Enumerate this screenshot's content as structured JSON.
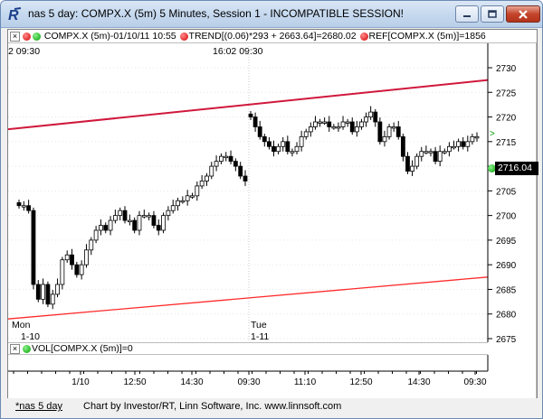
{
  "window": {
    "title": "nas 5 day: COMPX.X (5m) 5 Minutes, Session 1 - INCOMPATIBLE SESSION!",
    "app_icon": "investor-rt-logo",
    "controls": [
      "minimize-icon",
      "maximize-icon",
      "close-icon"
    ]
  },
  "legend": {
    "close_glyph": "×",
    "symbol": "COMPX.X (5m)-01/10/11 10:55",
    "trend": "TREND[(0.06)*293 + 2663.64]=2680.02",
    "ref": "REF[COMPX.X (5m)]=1856"
  },
  "time_labels_top": {
    "left": "2  09:30",
    "mid": "16:02  09:30"
  },
  "day_labels": {
    "mon": "Mon",
    "mon_date": "1-10",
    "tue": "Tue",
    "tue_date": "1-11"
  },
  "price_axis": {
    "ticks": [
      "2730",
      "2725",
      "2720",
      "2715",
      "2710",
      "2705",
      "2700",
      "2695",
      "2690",
      "2685",
      "2680",
      "2675"
    ],
    "last_price": "2716.04",
    "arrow": ">"
  },
  "volume_legend": {
    "close_glyph": "×",
    "label": "VOL[COMPX.X (5m)]=0"
  },
  "time_axis": {
    "ticks": [
      "1/10",
      "12:50",
      "14:30",
      "09:30",
      "11:10",
      "12:50",
      "14:30",
      "09:30"
    ]
  },
  "status": {
    "tab": "*nas 5 day",
    "credit": "Chart by Investor/RT, Linn Software, Inc. www.linnsoft.com"
  },
  "colors": {
    "trend_upper": "#d0183c",
    "trend_lower": "#ff2a2a",
    "candle_up": "#ffffff",
    "candle_down": "#000000"
  },
  "chart_data": {
    "type": "candlestick",
    "symbol": "COMPX.X (5m)",
    "ylim": [
      2675,
      2731
    ],
    "series": [
      {
        "name": "Mon 1-10",
        "close": [
          2702,
          2702,
          2701,
          2686,
          2683,
          2686,
          2682,
          2684,
          2686,
          2691,
          2692,
          2690,
          2688,
          2690,
          2693,
          2695,
          2697,
          2698,
          2697,
          2699,
          2700,
          2701,
          2699,
          2699,
          2697,
          2700,
          2700,
          2700,
          2698,
          2697,
          2700,
          2701,
          2702,
          2703,
          2703,
          2704,
          2704,
          2706,
          2707,
          2708,
          2710,
          2711,
          2712,
          2712,
          2711,
          2710,
          2708,
          2707
        ]
      },
      {
        "name": "Tue 1-11",
        "close": [
          2720,
          2718,
          2716,
          2715,
          2714,
          2713,
          2714,
          2715,
          2713,
          2713,
          2714,
          2716,
          2717,
          2718,
          2719,
          2719,
          2719,
          2718,
          2718,
          2718,
          2719,
          2719,
          2717,
          2718,
          2719,
          2720,
          2721,
          2719,
          2715,
          2716,
          2718,
          2718,
          2716,
          2712,
          2709,
          2710,
          2712,
          2713,
          2713,
          2713,
          2711,
          2713,
          2713,
          2714,
          2714,
          2715,
          2714,
          2715,
          2716,
          2716
        ]
      }
    ],
    "trend_upper": {
      "from": 2717.5,
      "to": 2727.5
    },
    "trend_lower": {
      "from": 2679.0,
      "to": 2687.5
    }
  }
}
